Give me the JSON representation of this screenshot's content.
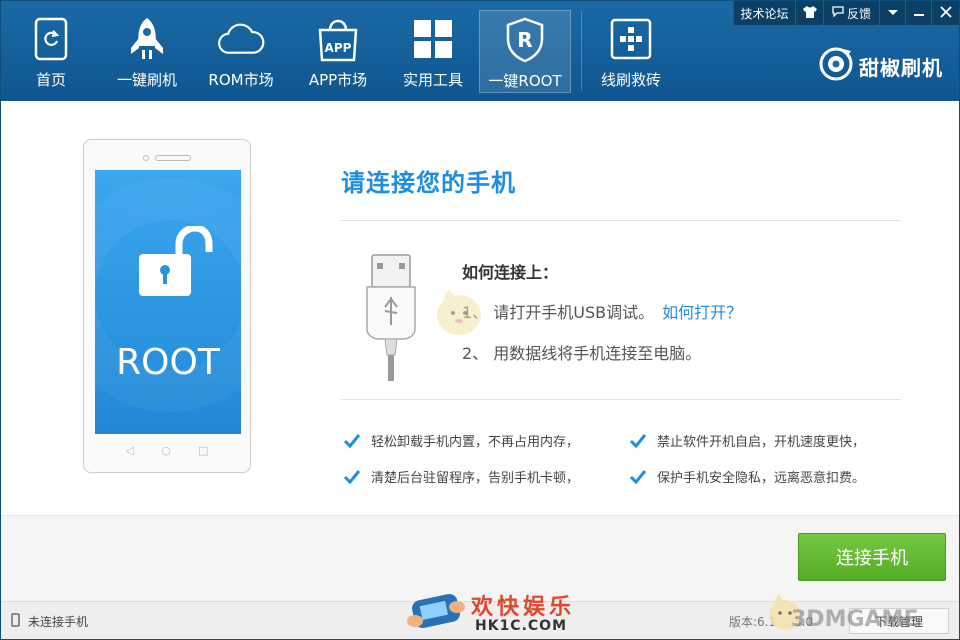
{
  "nav": {
    "items": [
      {
        "label": "首页",
        "icon": "refresh-phone-icon"
      },
      {
        "label": "一键刷机",
        "icon": "rocket-icon"
      },
      {
        "label": "ROM市场",
        "icon": "cloud-icon"
      },
      {
        "label": "APP市场",
        "icon": "app-bag-icon",
        "icon_text": "APP"
      },
      {
        "label": "实用工具",
        "icon": "grid-icon"
      },
      {
        "label": "一键ROOT",
        "icon": "shield-r-icon",
        "icon_text": "R",
        "active": true
      },
      {
        "label": "线刷救砖",
        "icon": "brick-icon"
      }
    ]
  },
  "topbar": {
    "forum": "技术论坛",
    "feedback": "反馈"
  },
  "brand": {
    "name": "甜椒刷机"
  },
  "phone": {
    "screen_text": "ROOT"
  },
  "main": {
    "title": "请连接您的手机",
    "how_title": "如何连接上：",
    "step1": "1、 请打开手机USB调试。",
    "step1_link": "如何打开？",
    "step2": "2、 用数据线将手机连接至电脑。"
  },
  "features": [
    "轻松卸载手机内置，不再占用内存，",
    "禁止软件开机自启，开机速度更快，",
    "清楚后台驻留程序，告别手机卡顿，",
    "保护手机安全隐私，远离恶意扣费。"
  ],
  "connect_button": "连接手机",
  "status": {
    "connection": "未连接手机",
    "version": "版本:6.1",
    "version_tail": "3.0",
    "download": "下载管理"
  },
  "watermarks": {
    "site_cn": "欢快娱乐",
    "site_url": "HK1C.COM",
    "site2": "3DMGAME"
  },
  "colors": {
    "header": "#1a6aa5",
    "accent": "#1e8fe0",
    "button": "#5fb630"
  }
}
